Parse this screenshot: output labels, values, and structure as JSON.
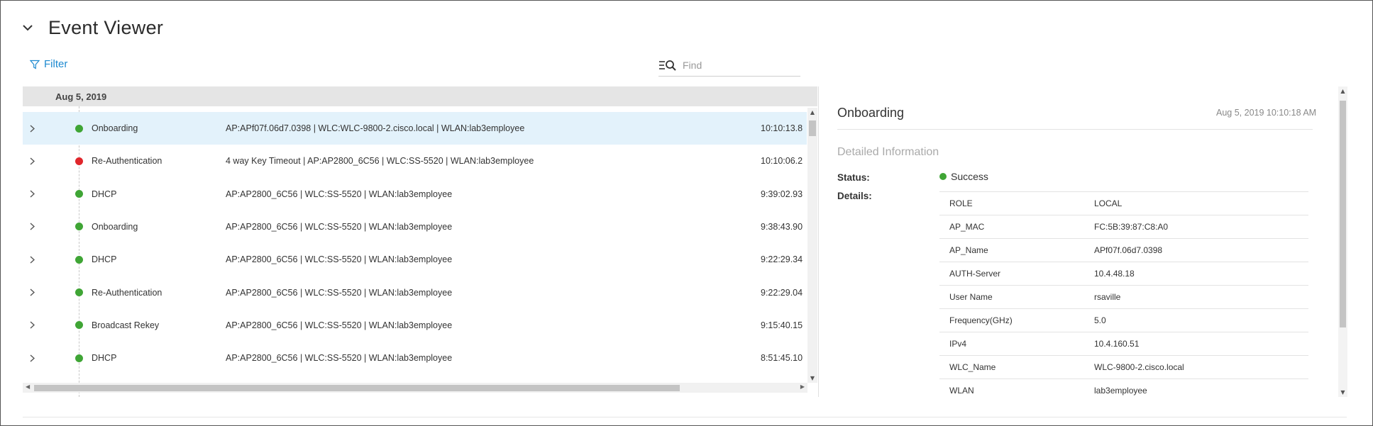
{
  "header": {
    "title": "Event Viewer",
    "collapse_icon": "chevron-down-icon"
  },
  "toolbar": {
    "filter_label": "Filter",
    "find_placeholder": "Find",
    "find_icon": "list-search-icon"
  },
  "colors": {
    "accent": "#1e8ad0",
    "success": "#3fa535",
    "failure": "#e0262b",
    "selected_row": "#e3f2fb"
  },
  "list": {
    "date": "Aug 5, 2019",
    "events": [
      {
        "event": "Onboarding",
        "details": "AP:APf07f.06d7.0398 | WLC:WLC-9800-2.cisco.local | WLAN:lab3employee",
        "time": "10:10:13.8",
        "status": "success",
        "selected": true
      },
      {
        "event": "Re-Authentication",
        "details": "4 way Key Timeout | AP:AP2800_6C56 | WLC:SS-5520 | WLAN:lab3employee",
        "time": "10:10:06.2",
        "status": "failure",
        "selected": false
      },
      {
        "event": "DHCP",
        "details": "AP:AP2800_6C56 | WLC:SS-5520 | WLAN:lab3employee",
        "time": "9:39:02.93",
        "status": "success",
        "selected": false
      },
      {
        "event": "Onboarding",
        "details": "AP:AP2800_6C56 | WLC:SS-5520 | WLAN:lab3employee",
        "time": "9:38:43.90",
        "status": "success",
        "selected": false
      },
      {
        "event": "DHCP",
        "details": "AP:AP2800_6C56 | WLC:SS-5520 | WLAN:lab3employee",
        "time": "9:22:29.34",
        "status": "success",
        "selected": false
      },
      {
        "event": "Re-Authentication",
        "details": "AP:AP2800_6C56 | WLC:SS-5520 | WLAN:lab3employee",
        "time": "9:22:29.04",
        "status": "success",
        "selected": false
      },
      {
        "event": "Broadcast Rekey",
        "details": "AP:AP2800_6C56 | WLC:SS-5520 | WLAN:lab3employee",
        "time": "9:15:40.15",
        "status": "success",
        "selected": false
      },
      {
        "event": "DHCP",
        "details": "AP:AP2800_6C56 | WLC:SS-5520 | WLAN:lab3employee",
        "time": "8:51:45.10",
        "status": "success",
        "selected": false
      }
    ]
  },
  "detail": {
    "title": "Onboarding",
    "timestamp": "Aug 5, 2019 10:10:18 AM",
    "subtitle": "Detailed Information",
    "status_label": "Status:",
    "status_value": "Success",
    "details_label": "Details:",
    "rows": [
      {
        "key": "ROLE",
        "value": "LOCAL"
      },
      {
        "key": "AP_MAC",
        "value": "FC:5B:39:87:C8:A0"
      },
      {
        "key": "AP_Name",
        "value": "APf07f.06d7.0398"
      },
      {
        "key": "AUTH-Server",
        "value": "10.4.48.18"
      },
      {
        "key": "User Name",
        "value": "rsaville"
      },
      {
        "key": "Frequency(GHz)",
        "value": "5.0"
      },
      {
        "key": "IPv4",
        "value": "10.4.160.51"
      },
      {
        "key": "WLC_Name",
        "value": "WLC-9800-2.cisco.local"
      },
      {
        "key": "WLAN",
        "value": "lab3employee"
      }
    ]
  }
}
